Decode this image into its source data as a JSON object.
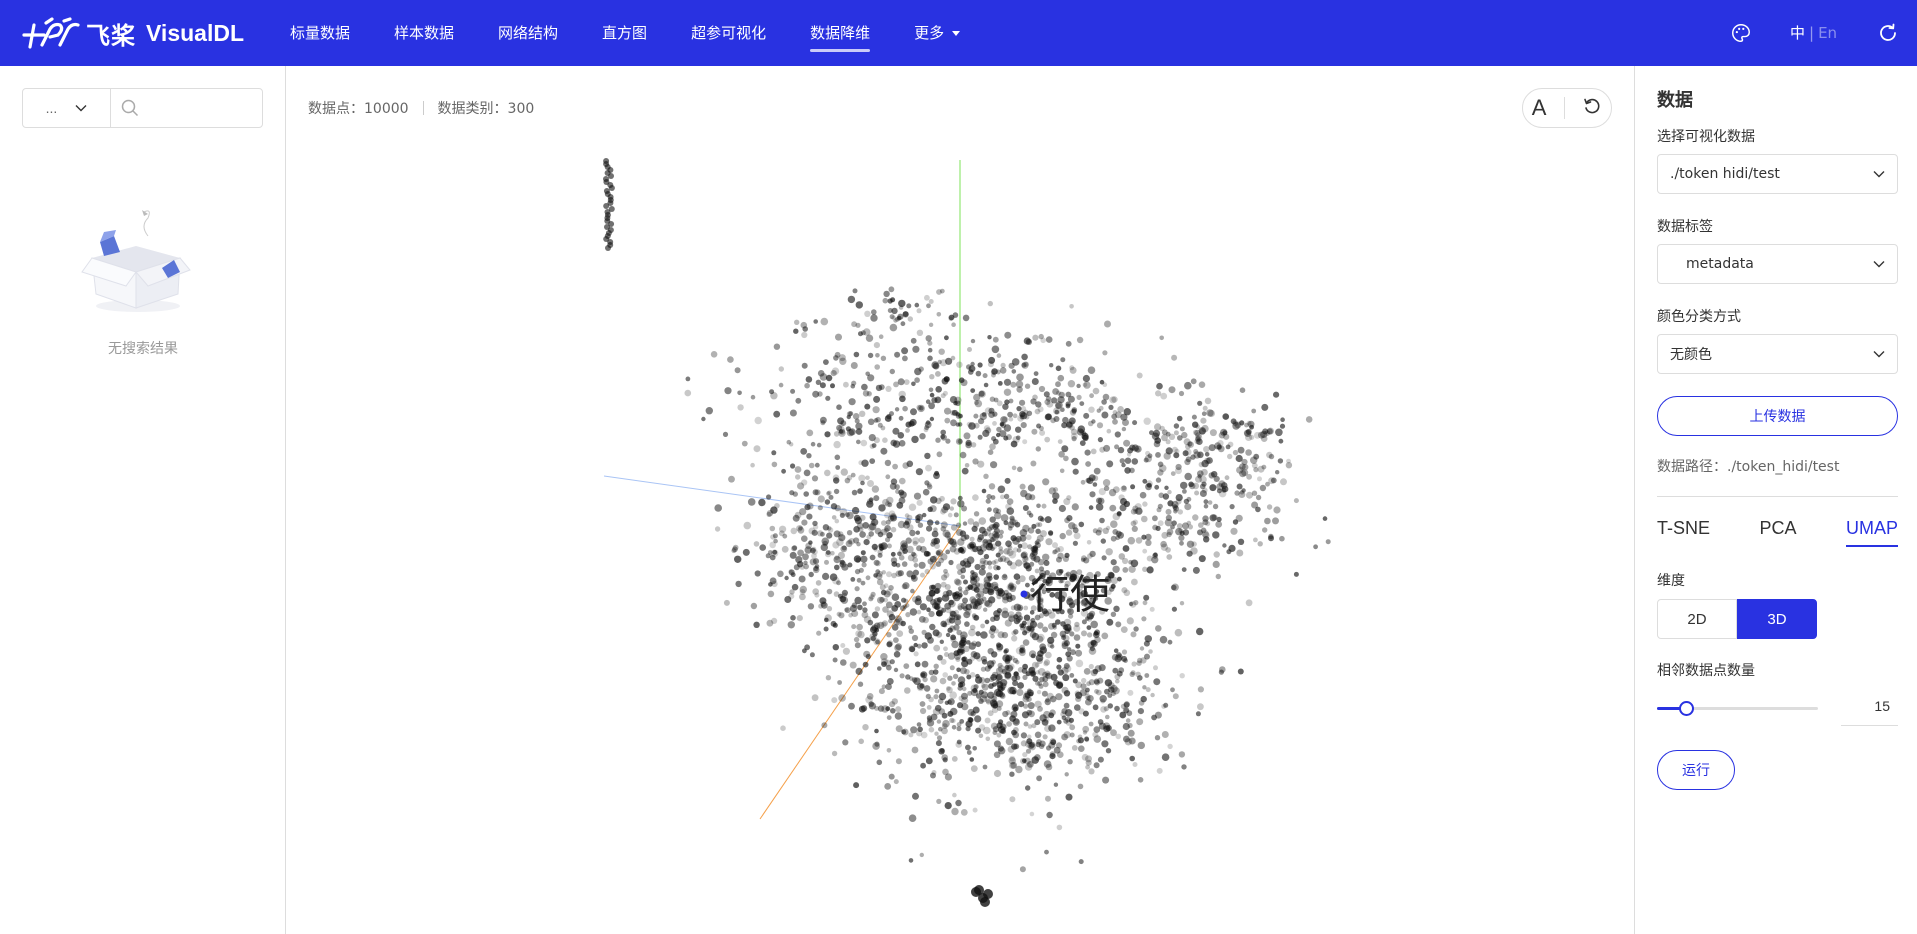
{
  "header": {
    "brand_cn": "飞桨",
    "brand_en": "VisualDL",
    "nav": [
      {
        "label": "标量数据",
        "active": false
      },
      {
        "label": "样本数据",
        "active": false
      },
      {
        "label": "网络结构",
        "active": false
      },
      {
        "label": "直方图",
        "active": false
      },
      {
        "label": "超参可视化",
        "active": false
      },
      {
        "label": "数据降维",
        "active": true
      },
      {
        "label": "更多",
        "active": false,
        "dropdown": true
      }
    ],
    "lang_active": "中",
    "lang_separator": "|",
    "lang_other": "En",
    "icons": {
      "theme": "palette-icon",
      "refresh": "refresh-icon"
    },
    "color": "#2932e1"
  },
  "left_panel": {
    "select_value": "...",
    "search_placeholder": "",
    "empty_text": "无搜索结果"
  },
  "main": {
    "stats": {
      "points_label": "数据点：10000",
      "classes_label": "数据类别：300"
    },
    "tools": {
      "label_toggle": "A"
    },
    "highlight_label": "行使"
  },
  "right_panel": {
    "title": "数据",
    "select_data_label": "选择可视化数据",
    "select_data_value": "./token  hidi/test",
    "label_label": "数据标签",
    "label_value": "metadata",
    "color_label": "颜色分类方式",
    "color_value": "无颜色",
    "upload_button": "上传数据",
    "path_text": "数据路径：./token_hidi/test",
    "algorithms": [
      {
        "label": "T-SNE",
        "active": false
      },
      {
        "label": "PCA",
        "active": false
      },
      {
        "label": "UMAP",
        "active": true
      }
    ],
    "dimension_label": "维度",
    "dimension_options": [
      {
        "label": "2D",
        "active": false
      },
      {
        "label": "3D",
        "active": true
      }
    ],
    "neighbors_label": "相邻数据点数量",
    "neighbors_value": "15",
    "neighbors_fraction": 0.18,
    "run_button": "运行"
  }
}
